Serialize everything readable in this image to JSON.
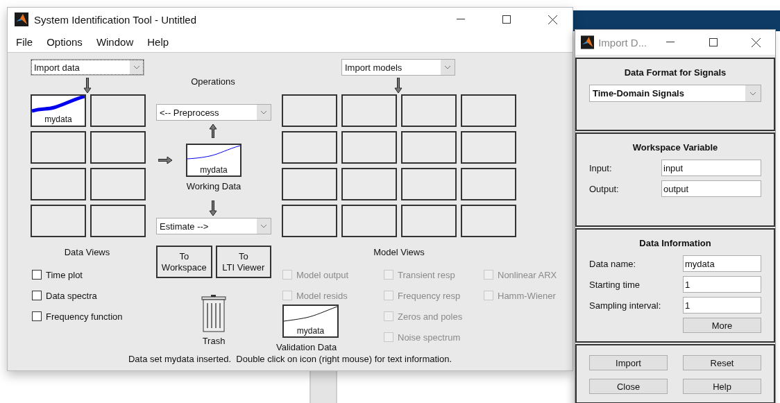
{
  "main_window": {
    "title": "System Identification Tool - Untitled",
    "menu": [
      "File",
      "Options",
      "Window",
      "Help"
    ],
    "import_data": {
      "value": "Import data"
    },
    "data_tiles": [
      {
        "kind": "data",
        "label": "mydata"
      },
      {
        "kind": "empty"
      },
      {
        "kind": "empty"
      },
      {
        "kind": "empty"
      },
      {
        "kind": "empty"
      },
      {
        "kind": "empty"
      },
      {
        "kind": "empty"
      },
      {
        "kind": "empty"
      }
    ],
    "operations": {
      "title": "Operations",
      "preprocess": "<-- Preprocess",
      "working_data": {
        "label": "mydata",
        "caption": "Working Data"
      },
      "estimate": "Estimate -->"
    },
    "buttons": [
      {
        "lines": [
          "To",
          "Workspace"
        ]
      },
      {
        "lines": [
          "To",
          "LTI Viewer"
        ]
      }
    ],
    "trash": "Trash",
    "data_views": {
      "title": "Data Views",
      "options": [
        {
          "label": "Time plot",
          "checked": false,
          "disabled": false
        },
        {
          "label": "Data spectra",
          "checked": false,
          "disabled": false
        },
        {
          "label": "Frequency function",
          "checked": false,
          "disabled": false
        }
      ]
    },
    "import_models": {
      "value": "Import models"
    },
    "model_tiles": [
      {
        "kind": "empty"
      },
      {
        "kind": "empty"
      },
      {
        "kind": "empty"
      },
      {
        "kind": "empty"
      },
      {
        "kind": "empty"
      },
      {
        "kind": "empty"
      },
      {
        "kind": "empty"
      },
      {
        "kind": "empty"
      },
      {
        "kind": "empty"
      },
      {
        "kind": "empty"
      },
      {
        "kind": "empty"
      },
      {
        "kind": "empty"
      },
      {
        "kind": "empty"
      },
      {
        "kind": "empty"
      },
      {
        "kind": "empty"
      },
      {
        "kind": "empty"
      }
    ],
    "model_views": {
      "title": "Model Views",
      "columns": [
        [
          {
            "label": "Model output",
            "checked": false,
            "disabled": true
          },
          {
            "label": "Model resids",
            "checked": false,
            "disabled": true
          }
        ],
        [
          {
            "label": "Transient resp",
            "checked": false,
            "disabled": true
          },
          {
            "label": "Frequency resp",
            "checked": false,
            "disabled": true
          },
          {
            "label": "Zeros and poles",
            "checked": false,
            "disabled": true
          },
          {
            "label": "Noise spectrum",
            "checked": false,
            "disabled": true
          }
        ],
        [
          {
            "label": "Nonlinear ARX",
            "checked": false,
            "disabled": true
          },
          {
            "label": "Hamm-Wiener",
            "checked": false,
            "disabled": true
          }
        ]
      ]
    },
    "validation_data": {
      "label": "mydata",
      "caption": "Validation Data"
    },
    "status": "Data set mydata inserted.  Double click on icon (right mouse) for text information."
  },
  "import_dialog": {
    "title": "Import D...",
    "format": {
      "title": "Data Format for Signals",
      "value": "Time-Domain Signals"
    },
    "workspace": {
      "title": "Workspace Variable",
      "fields": [
        {
          "label": "Input:",
          "value": "input"
        },
        {
          "label": "Output:",
          "value": "output"
        }
      ]
    },
    "info": {
      "title": "Data Information",
      "fields": [
        {
          "label": "Data name:",
          "value": "mydata"
        },
        {
          "label": "Starting time",
          "value": "1"
        },
        {
          "label": "Sampling interval:",
          "value": "1"
        }
      ],
      "more": "More"
    },
    "buttons": [
      "Import",
      "Reset",
      "Close",
      "Help"
    ]
  }
}
